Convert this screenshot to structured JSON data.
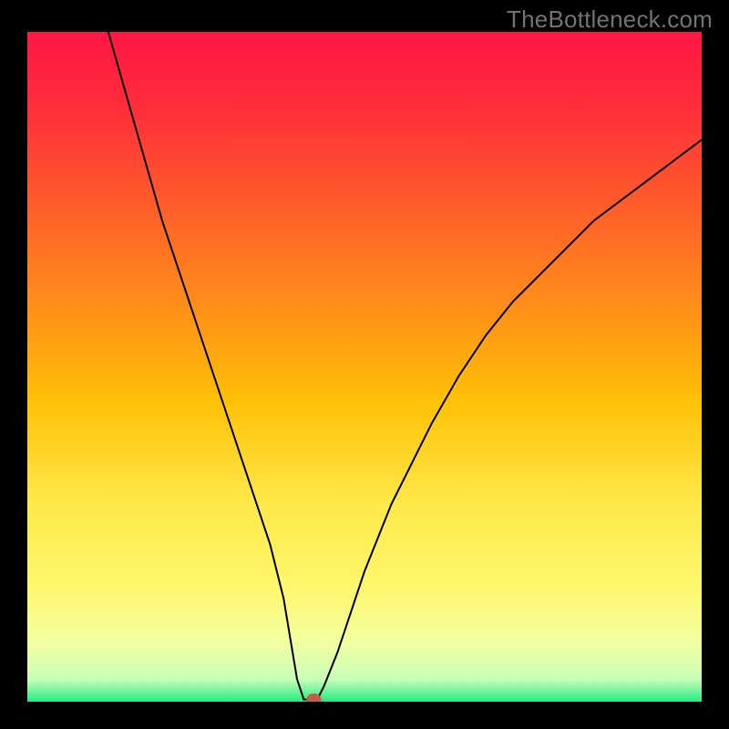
{
  "watermark": "TheBottleneck.com",
  "chart_data": {
    "type": "line",
    "title": "",
    "xlabel": "",
    "ylabel": "",
    "xlim": [
      0,
      100
    ],
    "ylim": [
      0,
      100
    ],
    "series": [
      {
        "name": "curve",
        "x": [
          12,
          14,
          16,
          18,
          20,
          22,
          24,
          26,
          28,
          30,
          32,
          34,
          36,
          38,
          39,
          40,
          41,
          42,
          43,
          44,
          46,
          48,
          50,
          52,
          54,
          56,
          58,
          60,
          64,
          68,
          72,
          76,
          80,
          84,
          88,
          92,
          96,
          100
        ],
        "y": [
          100,
          93,
          86,
          79,
          72,
          66,
          60,
          54,
          48,
          42,
          36,
          30,
          24,
          16,
          10,
          4,
          1,
          1,
          1,
          3,
          8,
          14,
          20,
          25,
          30,
          34,
          38,
          42,
          49,
          55,
          60,
          64,
          68,
          72,
          75,
          78,
          81,
          84
        ]
      }
    ],
    "marker": {
      "x": 42.5,
      "y": 1
    },
    "gradient_stops": [
      {
        "offset": 0.0,
        "color": "#ff1744"
      },
      {
        "offset": 0.1,
        "color": "#ff2a3c"
      },
      {
        "offset": 0.25,
        "color": "#ff5a2b"
      },
      {
        "offset": 0.4,
        "color": "#ff8c1a"
      },
      {
        "offset": 0.55,
        "color": "#ffc107"
      },
      {
        "offset": 0.7,
        "color": "#ffe94a"
      },
      {
        "offset": 0.82,
        "color": "#fff66b"
      },
      {
        "offset": 0.9,
        "color": "#f5ff9e"
      },
      {
        "offset": 0.96,
        "color": "#c9ffb8"
      },
      {
        "offset": 1.0,
        "color": "#00e676"
      }
    ]
  }
}
